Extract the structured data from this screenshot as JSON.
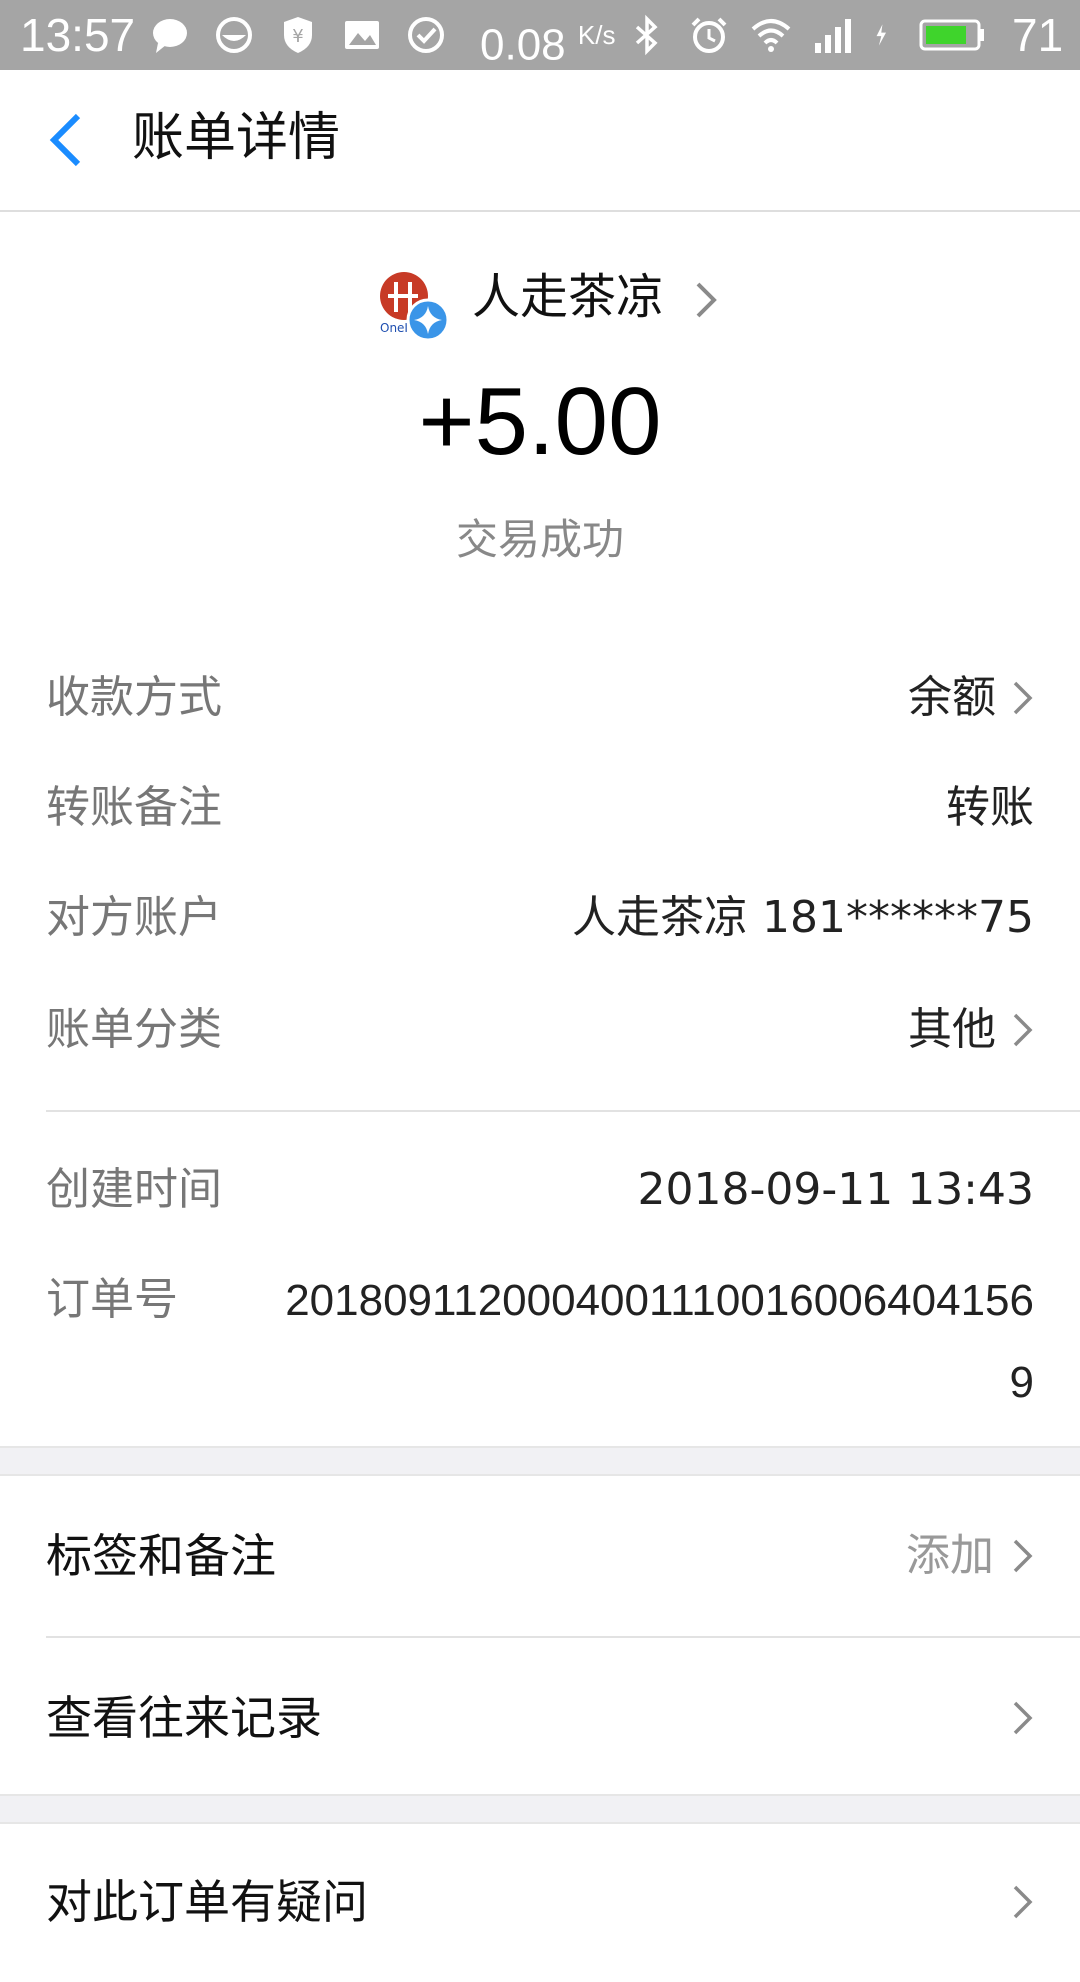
{
  "status_bar": {
    "time": "13:57",
    "speed_value": "0.08",
    "speed_unit": "K/s",
    "battery": "71",
    "icons": [
      "chat-icon",
      "smile-app-icon",
      "shield-yuan-icon",
      "image-icon",
      "check-circle-icon",
      "bluetooth-icon",
      "alarm-icon",
      "wifi-icon",
      "signal-icon",
      "charging-icon",
      "battery-icon"
    ],
    "battery_color": "#3fd42c"
  },
  "header": {
    "title": "账单详情",
    "back_icon": "chevron-left-icon",
    "accent": "#1a8cff"
  },
  "payer": {
    "name": "人走茶凉",
    "avatar_icon": "avatar-icon"
  },
  "amount": "+5.00",
  "status": "交易成功",
  "details": [
    {
      "label": "收款方式",
      "value": "余额",
      "chevron": true
    },
    {
      "label": "转账备注",
      "value": "转账",
      "chevron": false
    },
    {
      "label": "对方账户",
      "value": "人走茶凉 181******75",
      "chevron": false
    },
    {
      "label": "账单分类",
      "value": "其他",
      "chevron": true
    }
  ],
  "meta": {
    "created_label": "创建时间",
    "created_value": "2018-09-11 13:43",
    "order_label": "订单号",
    "order_value": "2018091120004001110016006404156 9"
  },
  "actions": [
    {
      "label": "标签和备注",
      "hint": "添加"
    },
    {
      "label": "查看往来记录",
      "hint": ""
    },
    {
      "label": "对此订单有疑问",
      "hint": ""
    }
  ]
}
